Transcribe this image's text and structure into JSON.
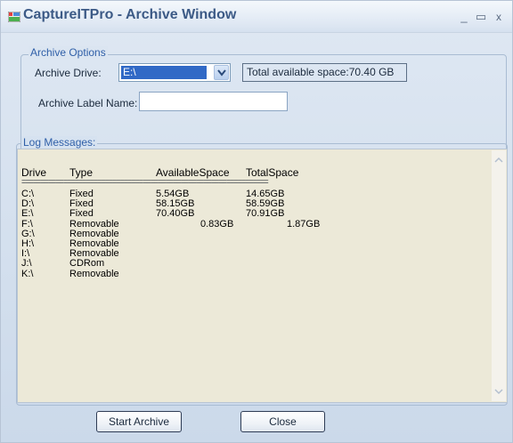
{
  "window": {
    "title": "CaptureITPro - Archive Window",
    "controls": {
      "minimize": "_",
      "maximize": "▭",
      "close": "x"
    }
  },
  "archive_options": {
    "legend": "Archive Options",
    "drive_label": "Archive Drive:",
    "drive_value": "E:\\",
    "available_space": "Total available space:70.40 GB",
    "label_name_label": "Archive Label Name:",
    "label_name_value": ""
  },
  "log": {
    "legend": "Log Messages:",
    "columns": [
      "Drive",
      "Type",
      "AvailableSpace",
      "TotalSpace"
    ],
    "separator": "=================================================================",
    "rows": [
      {
        "drive": "C:\\",
        "type": "Fixed",
        "available": "5.54GB",
        "total": "14.65GB"
      },
      {
        "drive": "D:\\",
        "type": "Fixed",
        "available": "58.15GB",
        "total": "58.59GB"
      },
      {
        "drive": "E:\\",
        "type": "Fixed",
        "available": "70.40GB",
        "total": "70.91GB"
      },
      {
        "drive": "F:\\",
        "type": "Removable",
        "available": "0.83GB",
        "total": "1.87GB"
      },
      {
        "drive": "G:\\",
        "type": "Removable",
        "available": "",
        "total": ""
      },
      {
        "drive": "H:\\",
        "type": "Removable",
        "available": "",
        "total": ""
      },
      {
        "drive": "I:\\",
        "type": "Removable",
        "available": "",
        "total": ""
      },
      {
        "drive": "J:\\",
        "type": "CDRom",
        "available": "",
        "total": ""
      },
      {
        "drive": "K:\\",
        "type": "Removable",
        "available": "",
        "total": ""
      }
    ]
  },
  "buttons": {
    "start": "Start Archive",
    "close": "Close"
  },
  "colors": {
    "selection": "#3169c6",
    "legend_text": "#2f5fa8",
    "title_text": "#3c5a86",
    "log_background": "#ece9d8"
  }
}
